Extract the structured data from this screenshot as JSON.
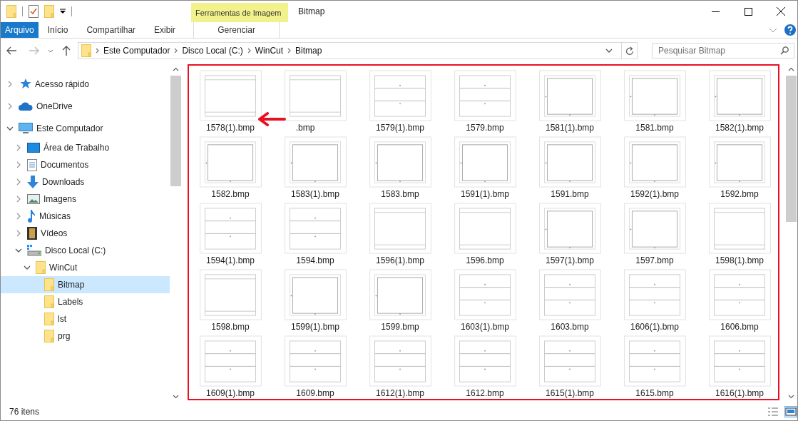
{
  "window": {
    "title": "Bitmap",
    "context_tab": "Ferramentas de Imagem"
  },
  "ribbon_tabs": [
    {
      "label": "Arquivo",
      "kind": "file",
      "selected": false
    },
    {
      "label": "Início",
      "kind": "tab",
      "selected": false
    },
    {
      "label": "Compartilhar",
      "kind": "tab",
      "selected": false
    },
    {
      "label": "Exibir",
      "kind": "tab",
      "selected": false
    },
    {
      "label": "Gerenciar",
      "kind": "context",
      "selected": false
    }
  ],
  "address": {
    "path": [
      "Este Computador",
      "Disco Local (C:)",
      "WinCut",
      "Bitmap"
    ],
    "search_placeholder": "Pesquisar Bitmap"
  },
  "sidebar": {
    "items": [
      {
        "label": "Acesso rápido",
        "kind": "quick",
        "expanded": false,
        "selected": false
      },
      {
        "label": "OneDrive",
        "kind": "cloud",
        "expanded": false,
        "selected": false
      },
      {
        "label": "Este Computador",
        "kind": "computer",
        "expanded": true,
        "selected": false,
        "children": [
          {
            "label": "Área de Trabalho",
            "kind": "desktop",
            "expanded": false,
            "selected": false
          },
          {
            "label": "Documentos",
            "kind": "documents",
            "expanded": false,
            "selected": false
          },
          {
            "label": "Downloads",
            "kind": "downloads",
            "expanded": false,
            "selected": false
          },
          {
            "label": "Imagens",
            "kind": "pictures",
            "expanded": false,
            "selected": false
          },
          {
            "label": "Músicas",
            "kind": "music",
            "expanded": false,
            "selected": false
          },
          {
            "label": "Vídeos",
            "kind": "videos",
            "expanded": false,
            "selected": false
          },
          {
            "label": "Disco Local (C:)",
            "kind": "drive",
            "expanded": true,
            "selected": false,
            "children": [
              {
                "label": "WinCut",
                "kind": "folder",
                "expanded": true,
                "selected": false,
                "children": [
                  {
                    "label": "Bitmap",
                    "kind": "folder",
                    "selected": true
                  },
                  {
                    "label": "Labels",
                    "kind": "folder",
                    "selected": false
                  },
                  {
                    "label": "lst",
                    "kind": "folder",
                    "selected": false
                  },
                  {
                    "label": "prg",
                    "kind": "folder",
                    "selected": false
                  }
                ]
              }
            ]
          }
        ]
      }
    ]
  },
  "files": [
    {
      "name": "1578(1).bmp",
      "kind": "frame"
    },
    {
      "name": ".bmp",
      "kind": "frame",
      "covered": true
    },
    {
      "name": "1579(1).bmp",
      "kind": "bands"
    },
    {
      "name": "1579.bmp",
      "kind": "bands"
    },
    {
      "name": "1581(1).bmp",
      "kind": "box"
    },
    {
      "name": "1581.bmp",
      "kind": "box"
    },
    {
      "name": "1582(1).bmp",
      "kind": "box"
    },
    {
      "name": "1582.bmp",
      "kind": "box"
    },
    {
      "name": "1583(1).bmp",
      "kind": "box"
    },
    {
      "name": "1583.bmp",
      "kind": "box"
    },
    {
      "name": "1591(1).bmp",
      "kind": "box"
    },
    {
      "name": "1591.bmp",
      "kind": "box"
    },
    {
      "name": "1592(1).bmp",
      "kind": "box"
    },
    {
      "name": "1592.bmp",
      "kind": "box"
    },
    {
      "name": "1594(1).bmp",
      "kind": "bands"
    },
    {
      "name": "1594.bmp",
      "kind": "bands"
    },
    {
      "name": "1596(1).bmp",
      "kind": "frame"
    },
    {
      "name": "1596.bmp",
      "kind": "frame"
    },
    {
      "name": "1597(1).bmp",
      "kind": "box"
    },
    {
      "name": "1597.bmp",
      "kind": "box"
    },
    {
      "name": "1598(1).bmp",
      "kind": "frame"
    },
    {
      "name": "1598.bmp",
      "kind": "frame"
    },
    {
      "name": "1599(1).bmp",
      "kind": "box"
    },
    {
      "name": "1599.bmp",
      "kind": "box"
    },
    {
      "name": "1603(1).bmp",
      "kind": "bands"
    },
    {
      "name": "1603.bmp",
      "kind": "bands"
    },
    {
      "name": "1606(1).bmp",
      "kind": "bands"
    },
    {
      "name": "1606.bmp",
      "kind": "bands"
    },
    {
      "name": "1609(1).bmp",
      "kind": "bands"
    },
    {
      "name": "1609.bmp",
      "kind": "bands"
    },
    {
      "name": "1612(1).bmp",
      "kind": "bands"
    },
    {
      "name": "1612.bmp",
      "kind": "bands"
    },
    {
      "name": "1615(1).bmp",
      "kind": "bands"
    },
    {
      "name": "1615.bmp",
      "kind": "bands"
    },
    {
      "name": "1616(1).bmp",
      "kind": "bands"
    }
  ],
  "status_bar": {
    "count": "76 itens"
  }
}
